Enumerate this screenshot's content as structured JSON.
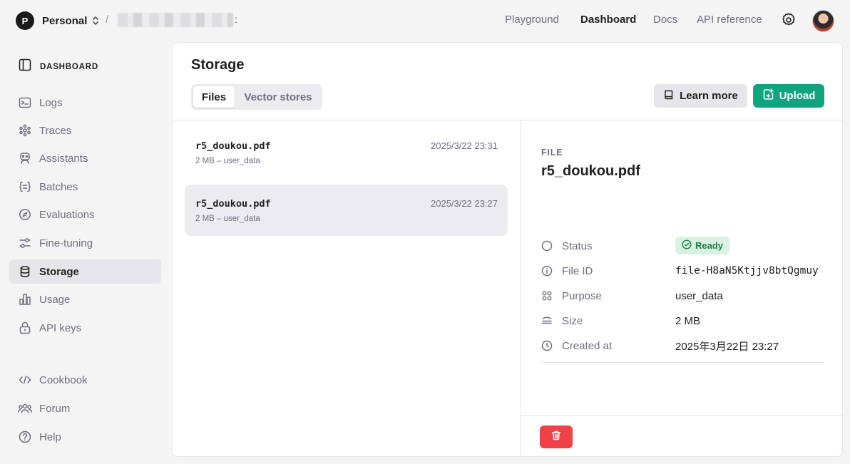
{
  "topbar": {
    "org_initial": "P",
    "org_name": "Personal",
    "crumb_separator": "/",
    "crumb_caret": ":",
    "nav": [
      {
        "label": "Playground",
        "active": false
      },
      {
        "label": "Dashboard",
        "active": true
      },
      {
        "label": "Docs",
        "active": false
      },
      {
        "label": "API reference",
        "active": false
      }
    ]
  },
  "sidebar": {
    "heading": "DASHBOARD",
    "items": [
      {
        "label": "Logs",
        "icon": "terminal-icon"
      },
      {
        "label": "Traces",
        "icon": "traces-icon"
      },
      {
        "label": "Assistants",
        "icon": "robot-icon"
      },
      {
        "label": "Batches",
        "icon": "braces-icon"
      },
      {
        "label": "Evaluations",
        "icon": "compass-icon"
      },
      {
        "label": "Fine-tuning",
        "icon": "sliders-icon"
      },
      {
        "label": "Storage",
        "icon": "database-icon",
        "active": true
      },
      {
        "label": "Usage",
        "icon": "bar-chart-icon"
      },
      {
        "label": "API keys",
        "icon": "lock-icon"
      }
    ],
    "bottom_items": [
      {
        "label": "Cookbook",
        "icon": "code-icon"
      },
      {
        "label": "Forum",
        "icon": "users-icon"
      },
      {
        "label": "Help",
        "icon": "help-icon"
      }
    ]
  },
  "main": {
    "title": "Storage",
    "tabs": [
      {
        "label": "Files",
        "active": true
      },
      {
        "label": "Vector stores",
        "active": false
      }
    ],
    "learn_more_label": "Learn more",
    "upload_label": "Upload",
    "files": [
      {
        "name": "r5_doukou.pdf",
        "date": "2025/3/22 23:31",
        "meta": "2 MB – user_data",
        "selected": false
      },
      {
        "name": "r5_doukou.pdf",
        "date": "2025/3/22 23:27",
        "meta": "2 MB – user_data",
        "selected": true
      }
    ]
  },
  "detail": {
    "label": "FILE",
    "title": "r5_doukou.pdf",
    "status_key": "Status",
    "status_value": "Ready",
    "file_id_key": "File ID",
    "file_id_value": "file-H8aN5Ktjjv8btQgmuy",
    "purpose_key": "Purpose",
    "purpose_value": "user_data",
    "size_key": "Size",
    "size_value": "2 MB",
    "created_key": "Created at",
    "created_value": "2025年3月22日 23:27"
  },
  "colors": {
    "accent_green": "#10a37f",
    "danger_red": "#ef4146",
    "ready_badge_bg": "#d8f2e2",
    "ready_badge_text": "#1a7f45"
  }
}
